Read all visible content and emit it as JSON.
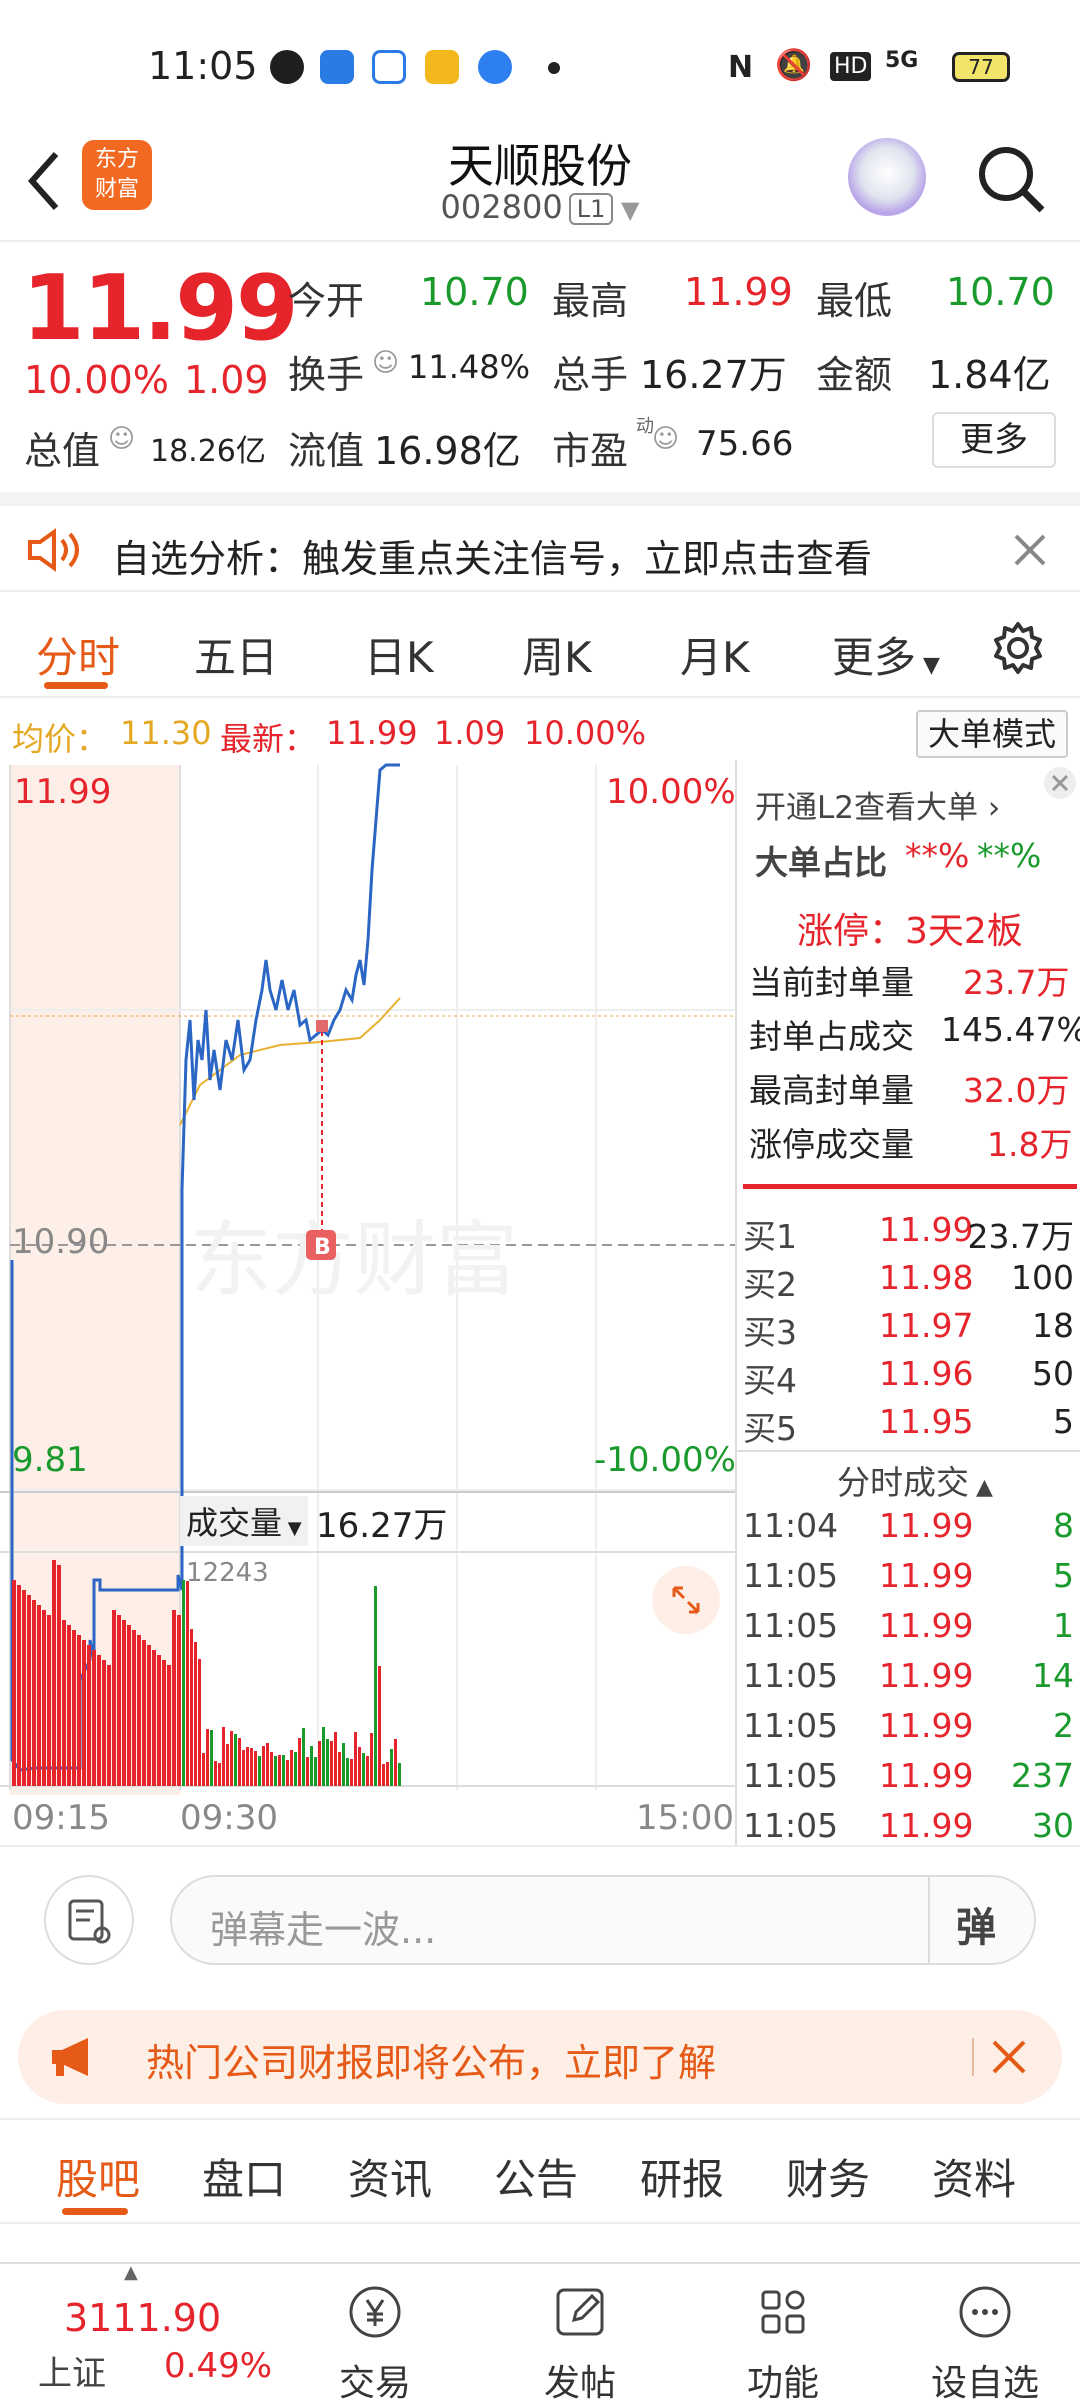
{
  "status_bar": {
    "time": "11:05",
    "battery": "77",
    "network": "5G",
    "hd": "HD"
  },
  "header": {
    "logo_line1": "东方",
    "logo_line2": "财富",
    "title": "天顺股份",
    "code": "002800",
    "level": "L1"
  },
  "quote": {
    "price": "11.99",
    "change_pct": "10.00%",
    "change": "1.09",
    "open_label": "今开",
    "open": "10.70",
    "high_label": "最高",
    "high": "11.99",
    "low_label": "最低",
    "low": "10.70",
    "turnover_label": "换手",
    "turnover": "11.48%",
    "volume_label": "总手",
    "volume": "16.27万",
    "amount_label": "金额",
    "amount": "1.84亿",
    "mktcap_label": "总值",
    "mktcap": "18.26亿",
    "float_label": "流值",
    "float": "16.98亿",
    "pe_label": "市盈",
    "pe_sup": "动",
    "pe": "75.66",
    "more": "更多"
  },
  "alert": {
    "text": "自选分析：触发重点关注信号，立即点击查看"
  },
  "chart_tabs": [
    "分时",
    "五日",
    "日K",
    "周K",
    "月K",
    "更多"
  ],
  "infoline": {
    "avg_label": "均价：",
    "avg": "11.30",
    "last_label": "最新：",
    "last": "11.99",
    "chg": "1.09",
    "pct": "10.00%",
    "mode_button": "大单模式"
  },
  "chart": {
    "top_price": "11.99",
    "top_pct": "10.00%",
    "mid_price": "10.90",
    "bottom_price": "9.81",
    "bottom_pct": "-10.00%",
    "watermark": "东方财富",
    "marker": "B",
    "volume_selector": "成交量",
    "volume_total": "16.27万",
    "volume_max": "12243",
    "time_start": "09:15",
    "time_mid": "09:30",
    "time_end": "15:00"
  },
  "side": {
    "l2_link": "开通L2查看大单",
    "big_label": "大单占比",
    "big_buy": "**%",
    "big_sell": "**%",
    "limit_text": "涨停：3天2板",
    "seal_label": "当前封单量",
    "seal": "23.7万",
    "ratio_label": "封单占成交",
    "ratio": "145.47%",
    "max_seal_label": "最高封单量",
    "max_seal": "32.0万",
    "limit_vol_label": "涨停成交量",
    "limit_vol": "1.8万",
    "bids": [
      {
        "label": "买1",
        "price": "11.99",
        "vol": "23.7万"
      },
      {
        "label": "买2",
        "price": "11.98",
        "vol": "100"
      },
      {
        "label": "买3",
        "price": "11.97",
        "vol": "18"
      },
      {
        "label": "买4",
        "price": "11.96",
        "vol": "50"
      },
      {
        "label": "买5",
        "price": "11.95",
        "vol": "5"
      }
    ],
    "ticks_title": "分时成交",
    "ticks": [
      {
        "time": "11:04",
        "price": "11.99",
        "vol": "8"
      },
      {
        "time": "11:05",
        "price": "11.99",
        "vol": "5"
      },
      {
        "time": "11:05",
        "price": "11.99",
        "vol": "1"
      },
      {
        "time": "11:05",
        "price": "11.99",
        "vol": "14"
      },
      {
        "time": "11:05",
        "price": "11.99",
        "vol": "2"
      },
      {
        "time": "11:05",
        "price": "11.99",
        "vol": "237"
      },
      {
        "time": "11:05",
        "price": "11.99",
        "vol": "30"
      }
    ]
  },
  "comment": {
    "placeholder": "弹幕走一波...",
    "danmu_label": "弹"
  },
  "promo": {
    "text": "热门公司财报即将公布，立即了解"
  },
  "news_tabs": [
    "股吧",
    "盘口",
    "资讯",
    "公告",
    "研报",
    "财务",
    "资料"
  ],
  "bottom": {
    "index_value": "3111.90",
    "index_name": "上证",
    "index_pct": "0.49%",
    "nav": [
      "交易",
      "发帖",
      "功能",
      "设自选"
    ]
  }
}
